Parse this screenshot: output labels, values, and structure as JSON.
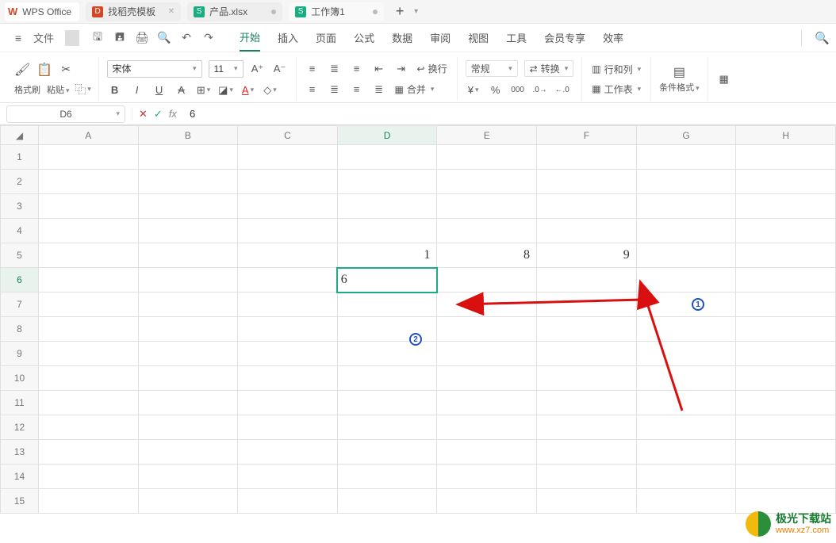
{
  "app": {
    "name": "WPS Office"
  },
  "tabs": [
    {
      "icon": "red",
      "iconLetter": "D",
      "label": "找稻壳模板",
      "state": "inactive"
    },
    {
      "icon": "green",
      "iconLetter": "S",
      "label": "产品.xlsx",
      "state": "dot"
    },
    {
      "icon": "green",
      "iconLetter": "S",
      "label": "工作簿1",
      "state": "dot-active"
    }
  ],
  "menu": {
    "file": "文件",
    "items": [
      "开始",
      "插入",
      "页面",
      "公式",
      "数据",
      "审阅",
      "视图",
      "工具",
      "会员专享",
      "效率"
    ],
    "activeIndex": 0
  },
  "ribbon": {
    "formatPainter": "格式刷",
    "paste": "粘贴",
    "fontName": "宋体",
    "fontSize": "11",
    "formatGeneral": "常规",
    "wrap": "换行",
    "merge": "合并",
    "convert": "转换",
    "rowsCols": "行和列",
    "worksheet": "工作表",
    "condFormat": "条件格式"
  },
  "formula": {
    "nameBox": "D6",
    "value": "6"
  },
  "columns": [
    "A",
    "B",
    "C",
    "D",
    "E",
    "F",
    "G",
    "H"
  ],
  "rows": [
    "1",
    "2",
    "3",
    "4",
    "5",
    "6",
    "7",
    "8",
    "9",
    "10",
    "11",
    "12",
    "13",
    "14",
    "15"
  ],
  "activeCell": {
    "row": 6,
    "col": "D",
    "editValue": "6"
  },
  "cells": {
    "D5": "1",
    "E5": "8",
    "F5": "9"
  },
  "annotations": {
    "badge1": "1",
    "badge2": "2"
  },
  "watermark": {
    "line1": "极光下载站",
    "line2": "www.xz7.com"
  },
  "chart_data": null
}
